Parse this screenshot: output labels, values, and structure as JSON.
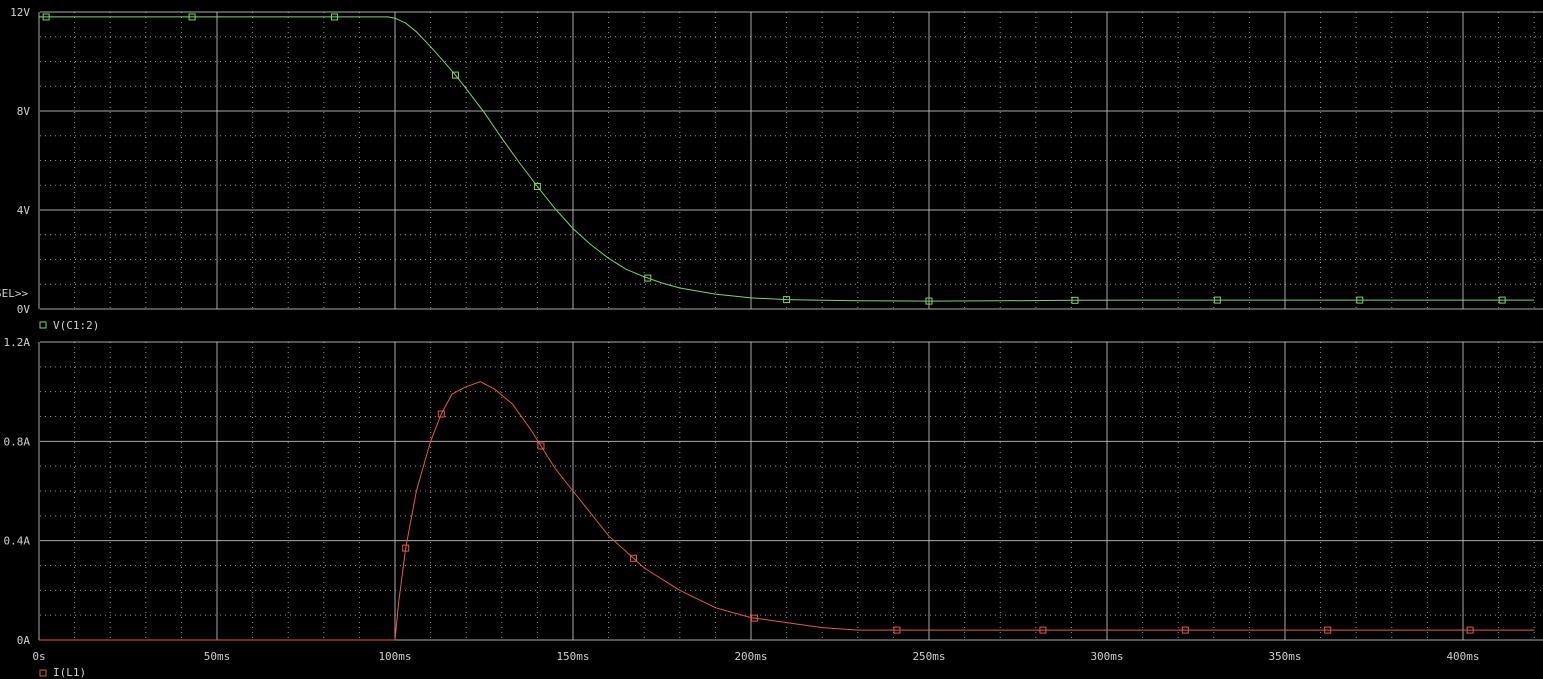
{
  "colors": {
    "background": "#000000",
    "grid": "#c8c8c8",
    "text": "#d0d0d0",
    "trace_voltage": "#7cd66a",
    "trace_current": "#e4574f"
  },
  "selector_text": "SEL>>",
  "chart_data": [
    {
      "type": "line",
      "xlim": [
        0,
        420
      ],
      "ylim": [
        0,
        12
      ],
      "grid": true,
      "x_tick_values": [
        0,
        50,
        100,
        150,
        200,
        250,
        300,
        350,
        400
      ],
      "y_tick_values": [
        0,
        4,
        8,
        12
      ],
      "y_tick_labels": [
        "0V",
        "4V",
        "8V",
        "12V"
      ],
      "legend": [
        {
          "label": "V(C1:2)",
          "color": "#7cd66a"
        }
      ],
      "series": [
        {
          "name": "V(C1:2)",
          "color": "#7cd66a",
          "x": [
            0,
            20,
            40,
            60,
            80,
            98,
            100,
            103,
            106,
            110,
            114,
            117,
            120,
            125,
            130,
            135,
            140,
            145,
            150,
            155,
            160,
            165,
            170,
            175,
            180,
            190,
            200,
            210,
            220,
            230,
            250,
            270,
            290,
            310,
            330,
            350,
            370,
            390,
            410,
            420
          ],
          "y": [
            11.8,
            11.8,
            11.8,
            11.8,
            11.8,
            11.8,
            11.75,
            11.55,
            11.2,
            10.6,
            9.95,
            9.45,
            8.9,
            7.95,
            6.9,
            5.9,
            4.95,
            4.05,
            3.25,
            2.6,
            2.05,
            1.6,
            1.3,
            1.05,
            0.85,
            0.6,
            0.45,
            0.38,
            0.35,
            0.33,
            0.32,
            0.33,
            0.35,
            0.36,
            0.36,
            0.36,
            0.36,
            0.36,
            0.36,
            0.36
          ]
        }
      ],
      "markers_x": [
        2,
        43,
        83,
        117,
        140,
        171,
        210,
        250,
        291,
        331,
        371,
        411
      ]
    },
    {
      "type": "line",
      "xlim": [
        0,
        420
      ],
      "ylim": [
        0,
        1.2
      ],
      "grid": true,
      "x_tick_values": [
        0,
        50,
        100,
        150,
        200,
        250,
        300,
        350,
        400
      ],
      "x_tick_labels": [
        "0s",
        "50ms",
        "100ms",
        "150ms",
        "200ms",
        "250ms",
        "300ms",
        "350ms",
        "400ms"
      ],
      "y_tick_values": [
        0,
        0.4,
        0.8,
        1.2
      ],
      "y_tick_labels": [
        "0A",
        "0.4A",
        "0.8A",
        "1.2A"
      ],
      "legend": [
        {
          "label": "I(L1)",
          "color": "#e4574f"
        }
      ],
      "series": [
        {
          "name": "I(L1)",
          "color": "#e4574f",
          "x": [
            0,
            20,
            40,
            60,
            80,
            100,
            101,
            103,
            106,
            110,
            113,
            116,
            120,
            124,
            128,
            133,
            138,
            145,
            150,
            160,
            170,
            180,
            190,
            200,
            210,
            220,
            230,
            240,
            260,
            280,
            300,
            320,
            340,
            360,
            380,
            400,
            420
          ],
          "y": [
            0,
            0,
            0,
            0,
            0,
            0,
            0.15,
            0.37,
            0.6,
            0.8,
            0.91,
            0.99,
            1.02,
            1.04,
            1.01,
            0.95,
            0.85,
            0.69,
            0.6,
            0.42,
            0.29,
            0.2,
            0.13,
            0.09,
            0.07,
            0.05,
            0.04,
            0.04,
            0.04,
            0.04,
            0.04,
            0.04,
            0.04,
            0.04,
            0.04,
            0.04,
            0.04
          ]
        }
      ],
      "markers_x": [
        103,
        113,
        141,
        167,
        201,
        241,
        282,
        322,
        362,
        402
      ]
    }
  ]
}
